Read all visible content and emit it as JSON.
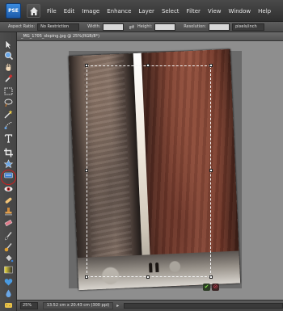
{
  "app": {
    "logo_text": "PSE"
  },
  "menu": [
    "File",
    "Edit",
    "Image",
    "Enhance",
    "Layer",
    "Select",
    "Filter",
    "View",
    "Window",
    "Help"
  ],
  "options": {
    "aspect_ratio_label": "Aspect Ratio:",
    "aspect_ratio_value": "No Restriction",
    "width_label": "Width:",
    "height_label": "Height:",
    "resolution_label": "Resolution:",
    "resolution_unit": "pixels/inch"
  },
  "document": {
    "tab_title": "_MG_1705_sloping.jpg @ 25%(RGB/8*)",
    "commit_icon": "check-icon",
    "cancel_icon": "cancel-icon"
  },
  "status": {
    "zoom": "25%",
    "doc_info": "13.52 cm x 20.43 cm (300 ppi)"
  },
  "tools": [
    "move-tool-icon",
    "zoom-tool-icon",
    "hand-tool-icon",
    "eyedropper-tool-icon",
    "marquee-tool-icon",
    "lasso-tool-icon",
    "magic-wand-tool-icon",
    "selection-brush-tool-icon",
    "type-tool-icon",
    "crop-tool-icon",
    "cookie-cutter-tool-icon",
    "straighten-tool-icon",
    "red-eye-tool-icon",
    "spot-healing-tool-icon",
    "clone-stamp-tool-icon",
    "eraser-tool-icon",
    "brush-tool-icon",
    "smart-brush-tool-icon",
    "paint-bucket-tool-icon",
    "gradient-tool-icon",
    "custom-shape-tool-icon",
    "blur-tool-icon",
    "sponge-tool-icon",
    "color-swatch-icon"
  ],
  "colors": {
    "active_tool_ring": "#cc1f1f",
    "commit_green": "#7edc4c",
    "cancel_red": "#e0455a"
  }
}
